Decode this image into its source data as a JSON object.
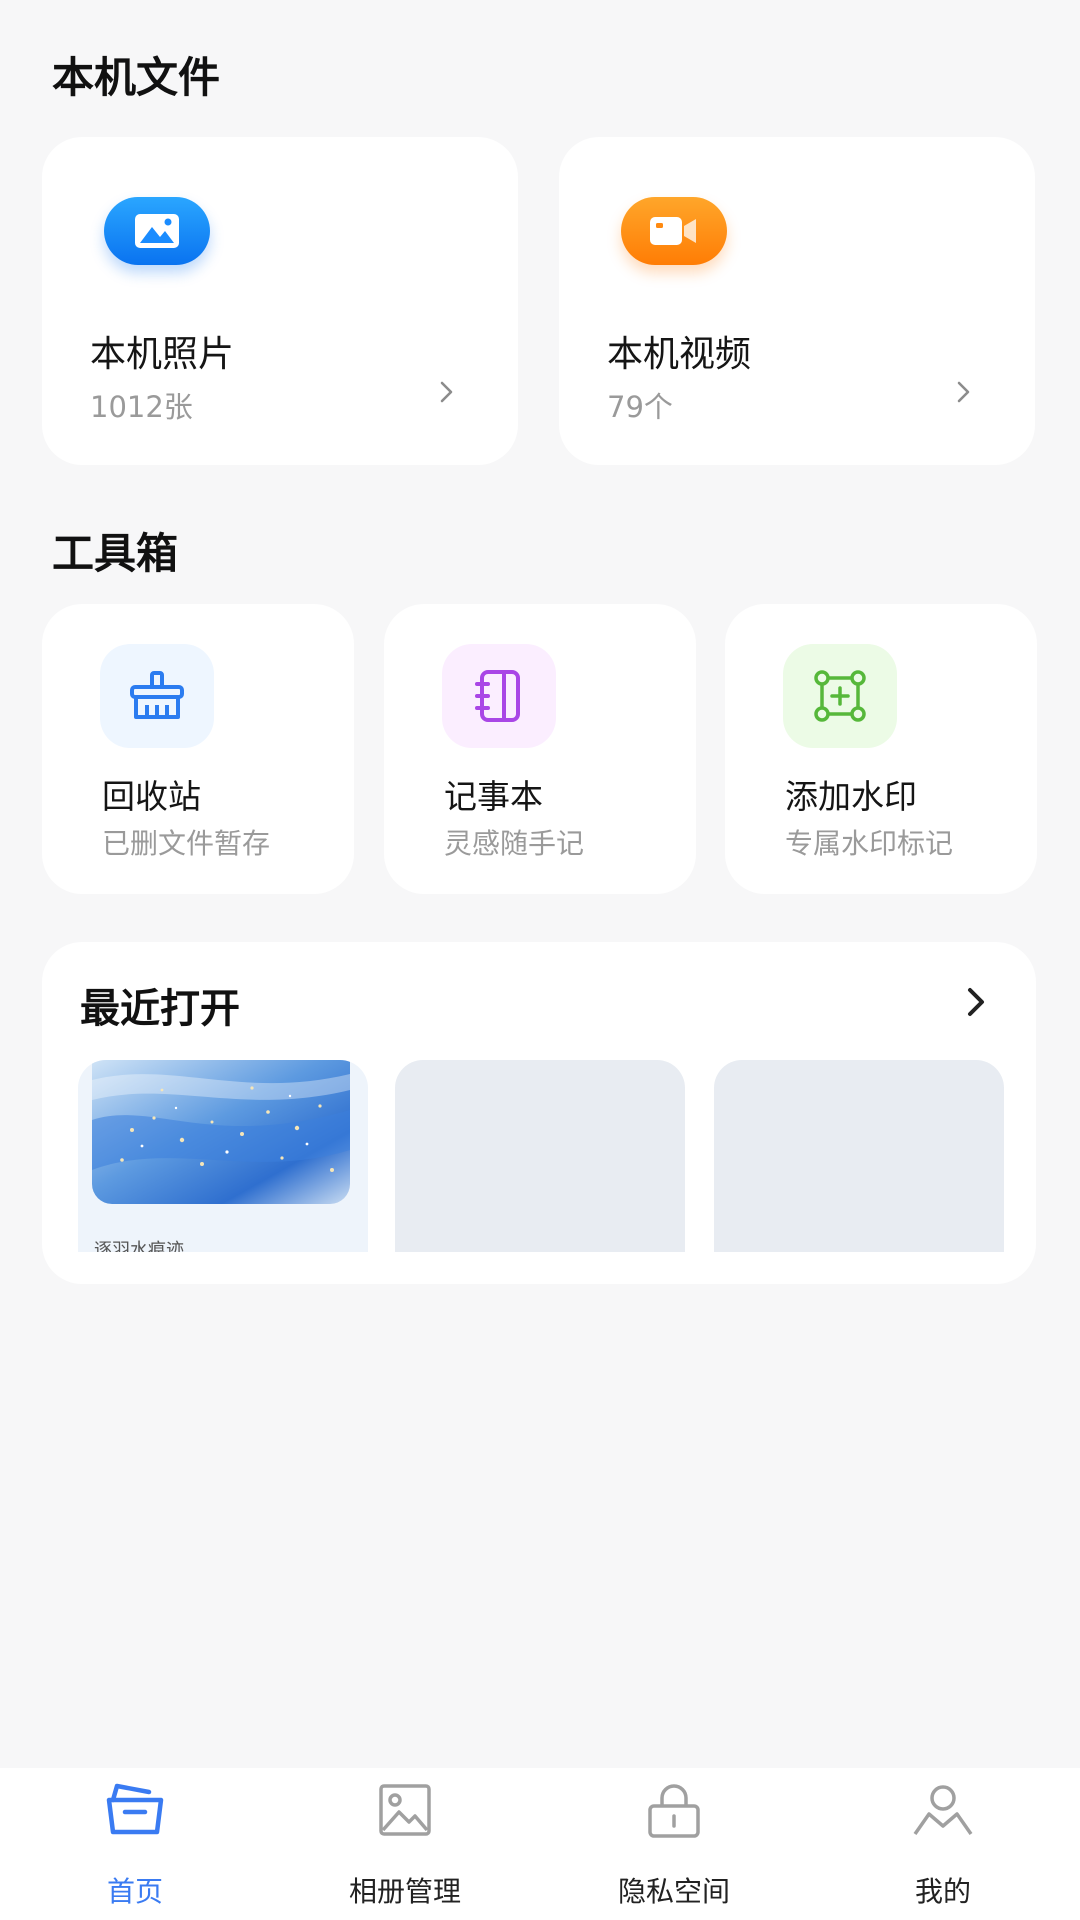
{
  "local_files": {
    "title": "本机文件",
    "photos": {
      "name": "本机照片",
      "count": "1012张",
      "icon": "image-icon",
      "color": "#1a8cff"
    },
    "videos": {
      "name": "本机视频",
      "count": "79个",
      "icon": "video-camera-icon",
      "color": "#ff8a10"
    }
  },
  "toolbox": {
    "title": "工具箱",
    "items": [
      {
        "name": "回收站",
        "desc": "已删文件暂存",
        "icon": "broom-icon",
        "color": "#2b7cf0"
      },
      {
        "name": "记事本",
        "desc": "灵感随手记",
        "icon": "notebook-icon",
        "color": "#a946e6"
      },
      {
        "name": "添加水印",
        "desc": "专属水印标记",
        "icon": "watermark-icon",
        "color": "#56b83a"
      }
    ]
  },
  "recent": {
    "title": "最近打开",
    "thumb_caption": "逐羽水痕迹"
  },
  "tabbar": {
    "items": [
      {
        "label": "首页",
        "icon": "basket-icon",
        "active": true
      },
      {
        "label": "相册管理",
        "icon": "picture-icon",
        "active": false
      },
      {
        "label": "隐私空间",
        "icon": "lock-icon",
        "active": false
      },
      {
        "label": "我的",
        "icon": "user-icon",
        "active": false
      }
    ],
    "active_color": "#3a7bf2"
  }
}
